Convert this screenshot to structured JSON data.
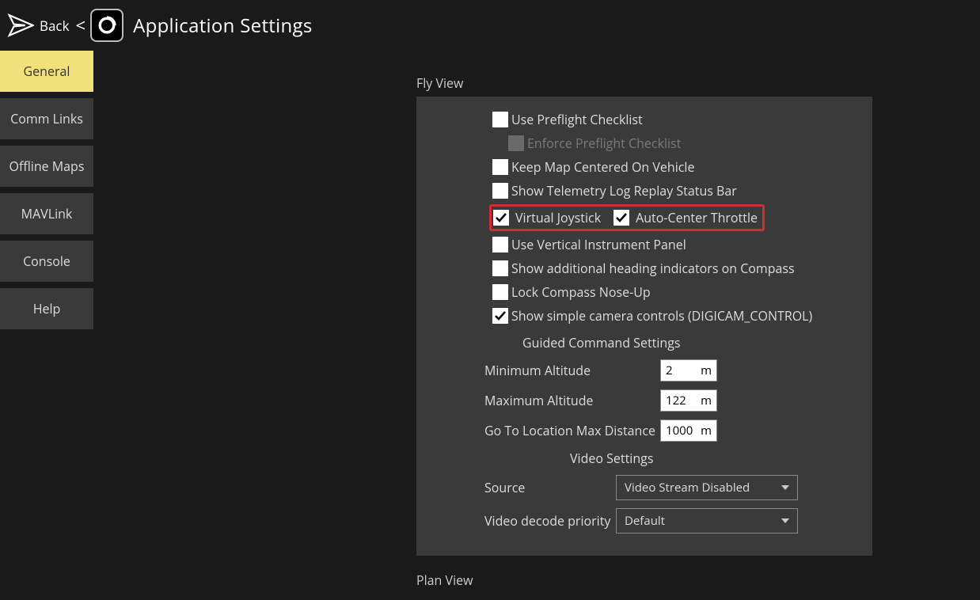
{
  "header": {
    "back": "Back",
    "title": "Application Settings"
  },
  "sidebar": {
    "items": [
      {
        "label": "General",
        "active": true
      },
      {
        "label": "Comm Links",
        "active": false
      },
      {
        "label": "Offline Maps",
        "active": false
      },
      {
        "label": "MAVLink",
        "active": false
      },
      {
        "label": "Console",
        "active": false
      },
      {
        "label": "Help",
        "active": false
      }
    ]
  },
  "flyview": {
    "header": "Fly View",
    "checks": {
      "preflight": {
        "label": "Use Preflight Checklist",
        "checked": false
      },
      "enforce_preflight": {
        "label": "Enforce Preflight Checklist",
        "checked": false,
        "disabled": true
      },
      "center_map": {
        "label": "Keep Map Centered On Vehicle",
        "checked": false
      },
      "telemetry_bar": {
        "label": "Show Telemetry Log Replay Status Bar",
        "checked": false
      },
      "virtual_joystick": {
        "label": "Virtual Joystick",
        "checked": true
      },
      "auto_center_throttle": {
        "label": "Auto-Center Throttle",
        "checked": true
      },
      "vertical_instrument": {
        "label": "Use Vertical Instrument Panel",
        "checked": false
      },
      "heading_indicators": {
        "label": "Show additional heading indicators on Compass",
        "checked": false
      },
      "lock_compass": {
        "label": "Lock Compass Nose-Up",
        "checked": false
      },
      "simple_camera": {
        "label": "Show simple camera controls (DIGICAM_CONTROL)",
        "checked": true
      }
    },
    "guided_header": "Guided Command Settings",
    "guided": {
      "min_alt": {
        "label": "Minimum Altitude",
        "value": "2",
        "unit": "m"
      },
      "max_alt": {
        "label": "Maximum Altitude",
        "value": "122",
        "unit": "m"
      },
      "goto_max": {
        "label": "Go To Location Max Distance",
        "value": "1000",
        "unit": "m"
      }
    },
    "video_header": "Video Settings",
    "video": {
      "source": {
        "label": "Source",
        "value": "Video Stream Disabled"
      },
      "decode": {
        "label": "Video decode priority",
        "value": "Default"
      }
    }
  },
  "planview": {
    "header": "Plan View"
  }
}
